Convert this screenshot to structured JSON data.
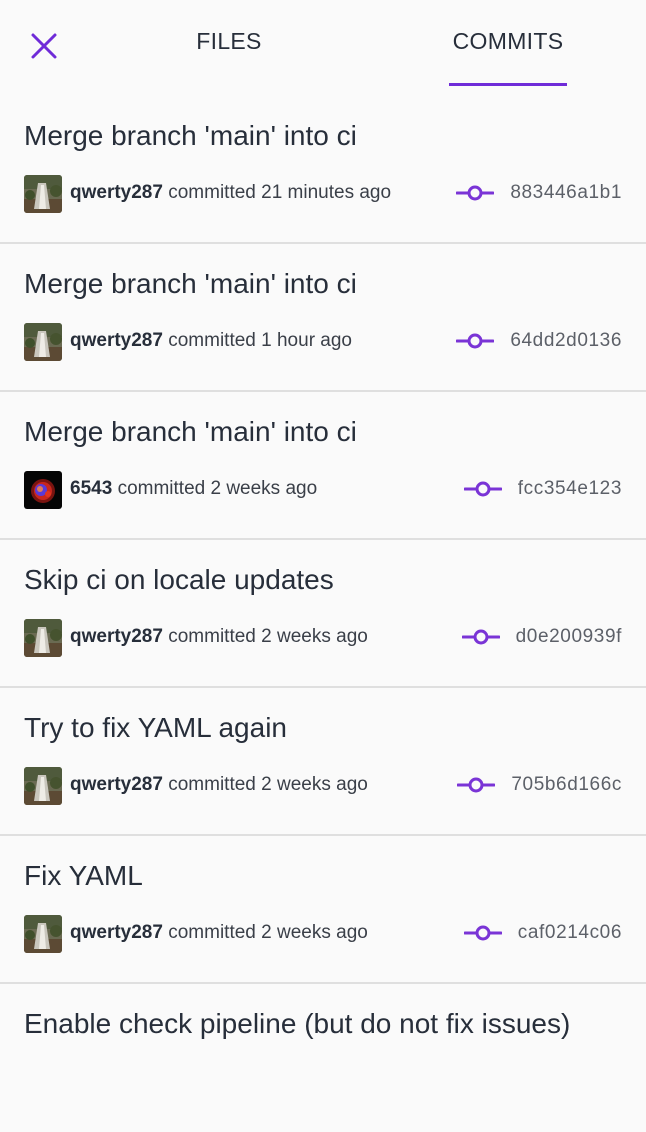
{
  "header": {
    "close_icon": "close-icon",
    "tabs": [
      {
        "label": "FILES",
        "active": false
      },
      {
        "label": "COMMITS",
        "active": true
      }
    ],
    "accent_color": "#6f2bd8"
  },
  "commits": [
    {
      "title": "Merge branch 'main' into ci",
      "user": "qwerty287",
      "action": "committed 21 minutes ago",
      "hash": "883446a1b1",
      "avatar": "landscape"
    },
    {
      "title": "Merge branch 'main' into ci",
      "user": "qwerty287",
      "action": "committed 1 hour ago",
      "hash": "64dd2d0136",
      "avatar": "landscape"
    },
    {
      "title": "Merge branch 'main' into ci",
      "user": "6543",
      "action": "committed 2 weeks ago",
      "hash": "fcc354e123",
      "avatar": "nebula"
    },
    {
      "title": "Skip ci on locale updates",
      "user": "qwerty287",
      "action": "committed 2 weeks ago",
      "hash": "d0e200939f",
      "avatar": "landscape"
    },
    {
      "title": "Try to fix YAML again",
      "user": "qwerty287",
      "action": "committed 2 weeks ago",
      "hash": "705b6d166c",
      "avatar": "landscape"
    },
    {
      "title": "Fix YAML",
      "user": "qwerty287",
      "action": "committed 2 weeks ago",
      "hash": "caf0214c06",
      "avatar": "landscape"
    },
    {
      "title": "Enable check pipeline (but do not fix issues)",
      "user": "",
      "action": "",
      "hash": "",
      "avatar": ""
    }
  ]
}
